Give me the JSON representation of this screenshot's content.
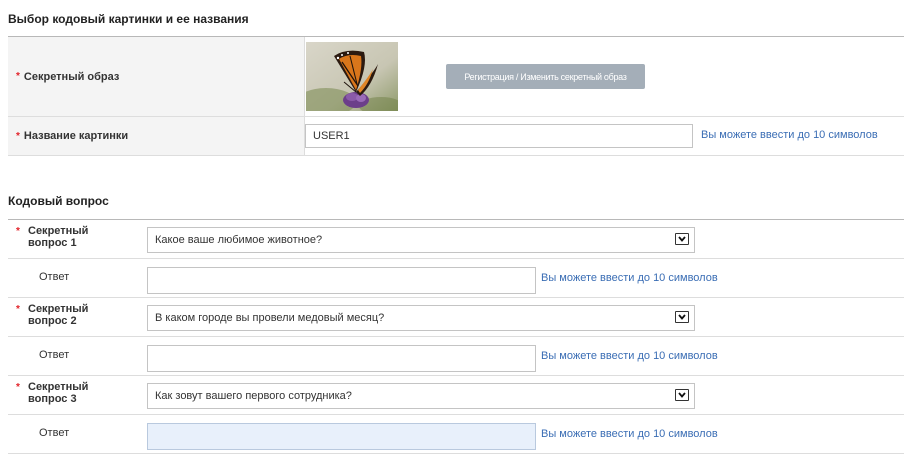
{
  "section_image": {
    "title": "Выбор кодовый картинки и ее названия",
    "image_label": "Секретный образ",
    "register_button": "Регистрация / Изменить секретный образ",
    "name_label": "Название картинки",
    "name_value": "USER1",
    "name_hint": "Вы можете ввести до 10 символов"
  },
  "section_questions": {
    "title": "Кодовый вопрос",
    "required_mark": "*",
    "questions": [
      {
        "label_line1": "Секретный",
        "label_line2": "вопрос 1",
        "selected": "Какое ваше любимое животное?",
        "answer_label": "Ответ",
        "answer_value": "",
        "hint": "Вы можете ввести до 10 символов"
      },
      {
        "label_line1": "Секретный",
        "label_line2": "вопрос 2",
        "selected": "В каком городе вы провели медовый месяц?",
        "answer_label": "Ответ",
        "answer_value": "",
        "hint": "Вы можете ввести до 10 символов"
      },
      {
        "label_line1": "Секретный",
        "label_line2": "вопрос 3",
        "selected": "Как зовут вашего первого сотрудника?",
        "answer_label": "Ответ",
        "answer_value": "",
        "hint": "Вы можете ввести до 10 символов"
      }
    ]
  },
  "colors": {
    "required": "#e2232a",
    "hint": "#3a6db4",
    "button_bg": "#a4aeb8",
    "label_bg": "#f4f4f4",
    "focused_input_bg": "#e8f0fb"
  },
  "icons": {
    "image": "butterfly-image",
    "dropdown": "chevron-down-icon"
  }
}
